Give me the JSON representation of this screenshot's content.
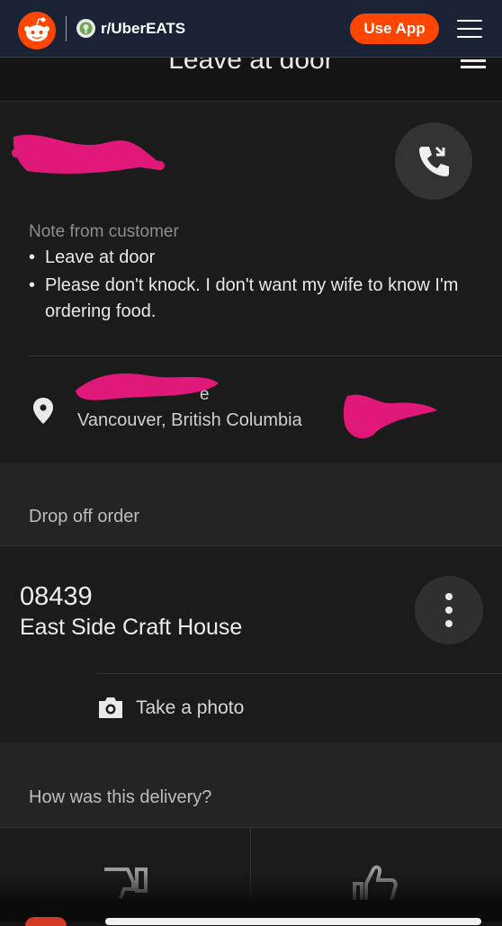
{
  "header": {
    "subreddit": "r/UberEATS",
    "use_app_label": "Use App"
  },
  "app": {
    "top_title": "Leave at door",
    "note": {
      "label": "Note from customer",
      "bullets": [
        "Leave at door",
        "Please don't knock. I don't want my wife to know I'm ordering food."
      ]
    },
    "address": {
      "line1_fragment": "e",
      "line2": "Vancouver, British Columbia"
    },
    "drop_off_label": "Drop off order",
    "order": {
      "id": "08439",
      "restaurant": "East Side Craft House",
      "photo_label": "Take a photo"
    },
    "feedback_label": "How was this delivery?"
  },
  "colors": {
    "reddit_orange": "#ff4500",
    "header_bg": "#1a2235",
    "redaction": "#e0187a"
  }
}
